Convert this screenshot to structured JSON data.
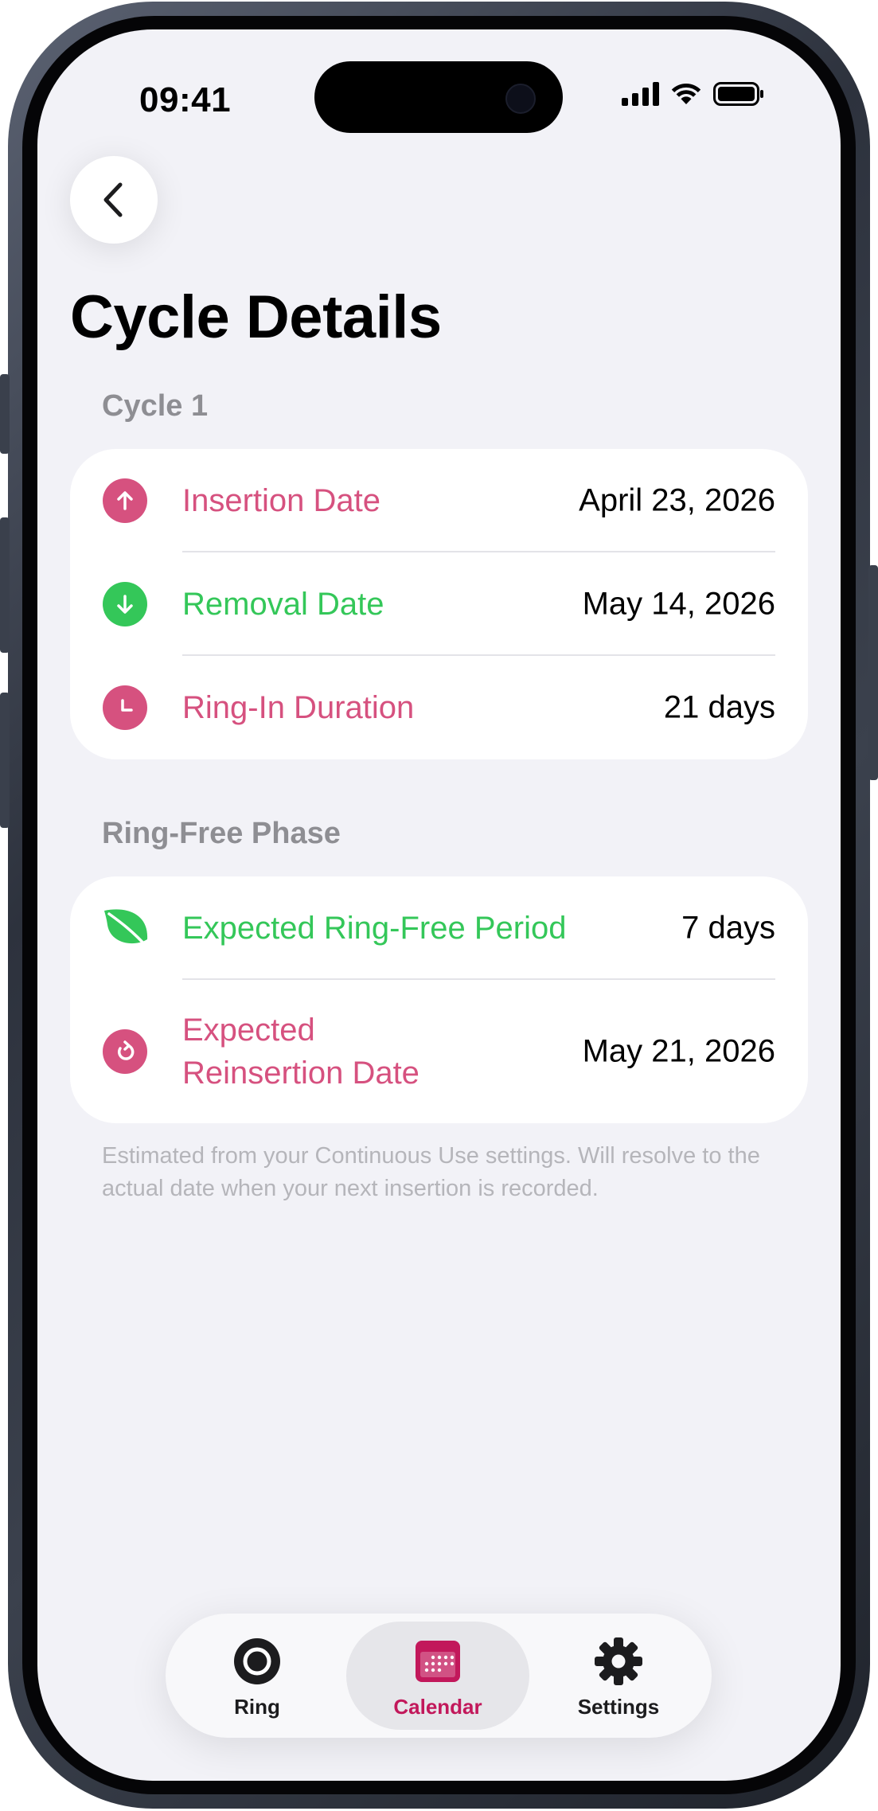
{
  "status": {
    "time": "09:41"
  },
  "header": {
    "title": "Cycle Details"
  },
  "sections": [
    {
      "title": "Cycle 1",
      "rows": [
        {
          "icon": "arrow-up-circle-icon",
          "label": "Insertion Date",
          "value": "April 23, 2026",
          "color": "#d6517f"
        },
        {
          "icon": "arrow-down-circle-icon",
          "label": "Removal Date",
          "value": "May 14, 2026",
          "color": "#34c759"
        },
        {
          "icon": "clock-icon",
          "label": "Ring-In Duration",
          "value": "21 days",
          "color": "#d6517f"
        }
      ]
    },
    {
      "title": "Ring-Free Phase",
      "rows": [
        {
          "icon": "leaf-icon",
          "label": "Expected Ring-Free Period",
          "value": "7 days",
          "color": "#34c759"
        },
        {
          "icon": "rotate-arrow-icon",
          "label_lines": [
            "Expected",
            "Reinsertion Date"
          ],
          "value": "May 21, 2026",
          "color": "#d6517f"
        }
      ]
    }
  ],
  "footnote": "Estimated from your Continuous Use settings. Will resolve to the actual date when your next insertion is recorded.",
  "tabbar": {
    "tabs": [
      {
        "label": "Ring",
        "icon": "ring-icon",
        "active": false
      },
      {
        "label": "Calendar",
        "icon": "calendar-icon",
        "active": true
      },
      {
        "label": "Settings",
        "icon": "gear-icon",
        "active": false
      }
    ]
  },
  "colors": {
    "accent_pink": "#d6517f",
    "accent_green": "#34c759",
    "active_tab": "#c2185b"
  }
}
